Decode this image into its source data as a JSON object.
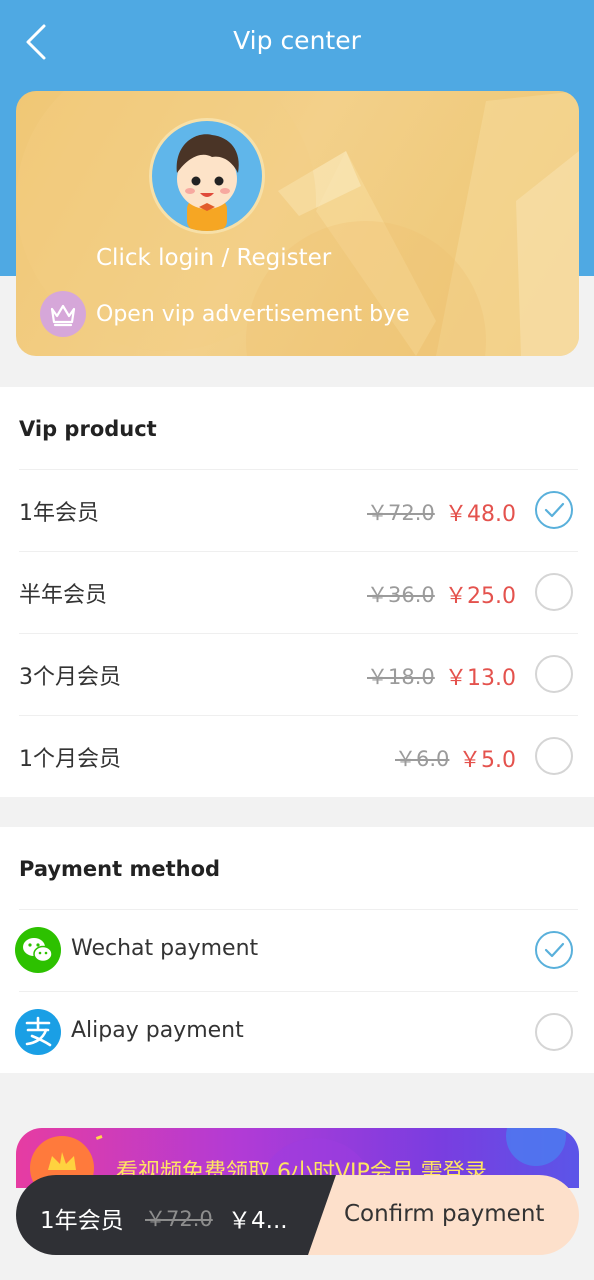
{
  "header": {
    "title": "Vip center"
  },
  "card": {
    "login_text": "Click login / Register",
    "vip_tip": "Open vip advertisement bye"
  },
  "products": {
    "title": "Vip product",
    "items": [
      {
        "name": "1年会员",
        "old_price": "￥72.0",
        "price": "￥48.0",
        "selected": true
      },
      {
        "name": "半年会员",
        "old_price": "￥36.0",
        "price": "￥25.0",
        "selected": false
      },
      {
        "name": "3个月会员",
        "old_price": "￥18.0",
        "price": "￥13.0",
        "selected": false
      },
      {
        "name": "1个月会员",
        "old_price": "￥6.0",
        "price": "￥5.0",
        "selected": false
      }
    ]
  },
  "payment": {
    "title": "Payment method",
    "methods": [
      {
        "name": "Wechat payment",
        "icon": "wechat-icon",
        "selected": true
      },
      {
        "name": "Alipay payment",
        "icon": "alipay-icon",
        "selected": false
      }
    ]
  },
  "banner": {
    "text": "看视频免费领取 6小时VIP会员 需登录"
  },
  "bottom_bar": {
    "plan": "1年会员",
    "old_price": "￥72.0",
    "price": "￥4...",
    "confirm_label": "Confirm payment"
  },
  "colors": {
    "header_blue": "#4fa9e3",
    "price_red": "#e4524d",
    "check_blue": "#59b0db",
    "wechat_green": "#2dc100",
    "alipay_blue": "#1a9fe5",
    "bar_dark": "#2f3035",
    "confirm_bg": "#fde0cb"
  }
}
